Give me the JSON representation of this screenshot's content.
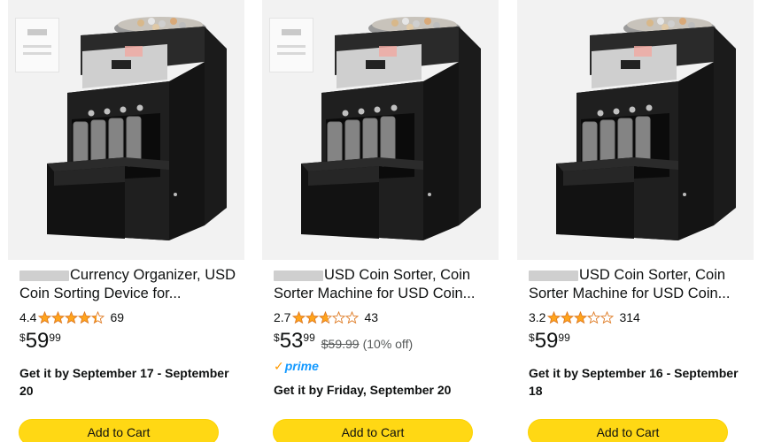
{
  "products": [
    {
      "title": "Currency Organizer, USD Coin Sorting Device for...",
      "rating": "4.4",
      "rating_value": 4.4,
      "review_count": "69",
      "price": {
        "currency": "$",
        "whole": "59",
        "fraction": "99"
      },
      "was_price": "",
      "discount": "",
      "prime": "",
      "delivery": "Get it by September 17 - September 20",
      "add_to_cart": "Add to Cart"
    },
    {
      "title": "USD Coin Sorter, Coin Sorter Machine for USD Coin...",
      "rating": "2.7",
      "rating_value": 2.7,
      "review_count": "43",
      "price": {
        "currency": "$",
        "whole": "53",
        "fraction": "99"
      },
      "was_price": "$59.99",
      "discount": "(10% off)",
      "prime": "prime",
      "delivery": "Get it by Friday, September 20",
      "add_to_cart": "Add to Cart"
    },
    {
      "title": "USD Coin Sorter, Coin Sorter Machine for USD Coin...",
      "rating": "3.2",
      "rating_value": 3.2,
      "review_count": "314",
      "price": {
        "currency": "$",
        "whole": "59",
        "fraction": "99"
      },
      "was_price": "",
      "discount": "",
      "prime": "",
      "delivery": "Get it by September 16 - September 18",
      "add_to_cart": "Add to Cart"
    }
  ],
  "icons": {
    "star": "star-icon",
    "prime_check": "prime-check-icon",
    "product_image": "coin-sorter-image"
  },
  "colors": {
    "star": "#ffa41c",
    "button": "#ffd814",
    "prime": "#1399ff",
    "prime_check": "#ff9900"
  }
}
